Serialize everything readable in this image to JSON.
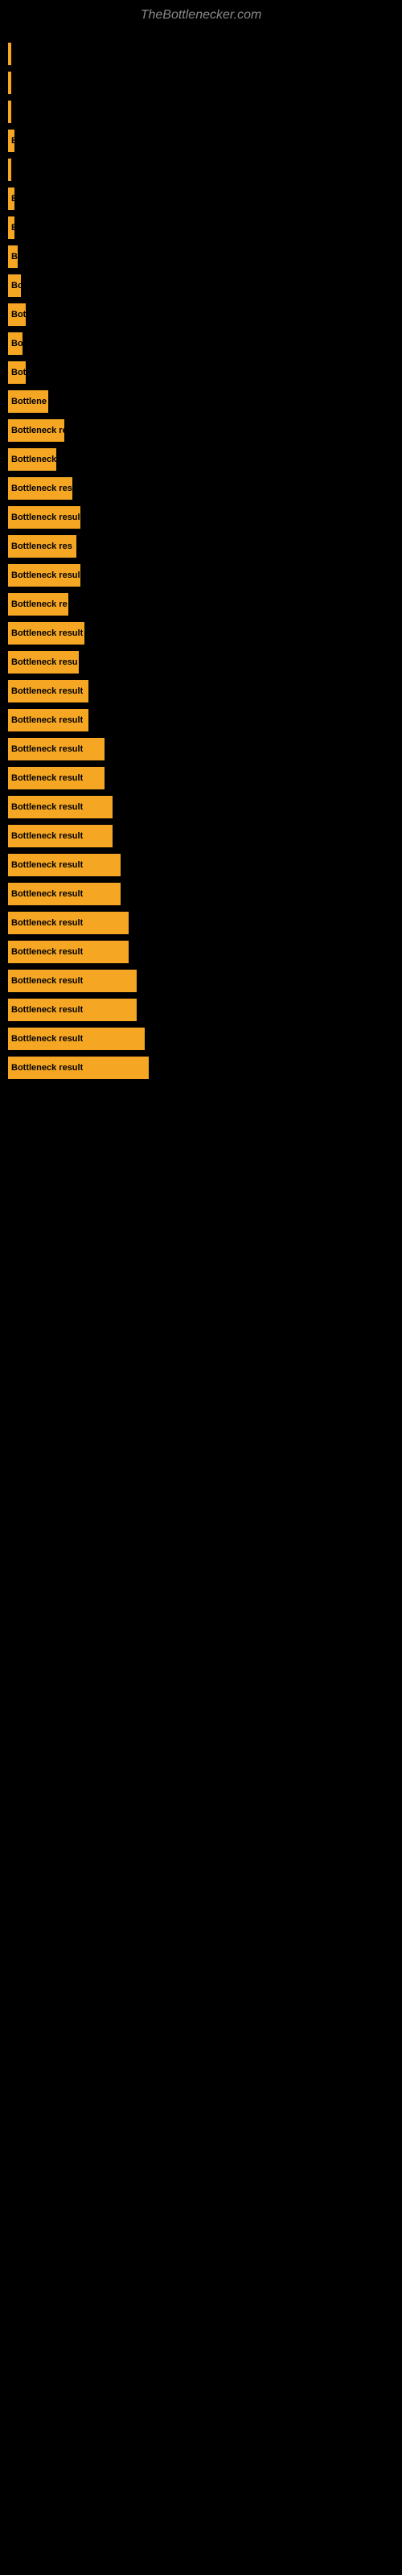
{
  "site": {
    "title": "TheBottlenecker.com"
  },
  "bars": [
    {
      "id": 1,
      "width": 4,
      "label": ""
    },
    {
      "id": 2,
      "width": 4,
      "label": ""
    },
    {
      "id": 3,
      "width": 4,
      "label": ""
    },
    {
      "id": 4,
      "width": 8,
      "label": "E"
    },
    {
      "id": 5,
      "width": 4,
      "label": ""
    },
    {
      "id": 6,
      "width": 8,
      "label": "E"
    },
    {
      "id": 7,
      "width": 8,
      "label": "E"
    },
    {
      "id": 8,
      "width": 12,
      "label": "B"
    },
    {
      "id": 9,
      "width": 16,
      "label": "Bo"
    },
    {
      "id": 10,
      "width": 22,
      "label": "Bott"
    },
    {
      "id": 11,
      "width": 18,
      "label": "Bo"
    },
    {
      "id": 12,
      "width": 22,
      "label": "Bott"
    },
    {
      "id": 13,
      "width": 50,
      "label": "Bottlene"
    },
    {
      "id": 14,
      "width": 70,
      "label": "Bottleneck re"
    },
    {
      "id": 15,
      "width": 60,
      "label": "Bottleneck"
    },
    {
      "id": 16,
      "width": 80,
      "label": "Bottleneck res"
    },
    {
      "id": 17,
      "width": 90,
      "label": "Bottleneck result"
    },
    {
      "id": 18,
      "width": 85,
      "label": "Bottleneck res"
    },
    {
      "id": 19,
      "width": 90,
      "label": "Bottleneck result"
    },
    {
      "id": 20,
      "width": 75,
      "label": "Bottleneck re"
    },
    {
      "id": 21,
      "width": 95,
      "label": "Bottleneck result"
    },
    {
      "id": 22,
      "width": 88,
      "label": "Bottleneck resu"
    },
    {
      "id": 23,
      "width": 100,
      "label": "Bottleneck result"
    },
    {
      "id": 24,
      "width": 100,
      "label": "Bottleneck result"
    },
    {
      "id": 25,
      "width": 120,
      "label": "Bottleneck result"
    },
    {
      "id": 26,
      "width": 120,
      "label": "Bottleneck result"
    },
    {
      "id": 27,
      "width": 130,
      "label": "Bottleneck result"
    },
    {
      "id": 28,
      "width": 130,
      "label": "Bottleneck result"
    },
    {
      "id": 29,
      "width": 140,
      "label": "Bottleneck result"
    },
    {
      "id": 30,
      "width": 140,
      "label": "Bottleneck result"
    },
    {
      "id": 31,
      "width": 150,
      "label": "Bottleneck result"
    },
    {
      "id": 32,
      "width": 150,
      "label": "Bottleneck result"
    },
    {
      "id": 33,
      "width": 160,
      "label": "Bottleneck result"
    },
    {
      "id": 34,
      "width": 160,
      "label": "Bottleneck result"
    },
    {
      "id": 35,
      "width": 170,
      "label": "Bottleneck result"
    },
    {
      "id": 36,
      "width": 175,
      "label": "Bottleneck result"
    }
  ]
}
